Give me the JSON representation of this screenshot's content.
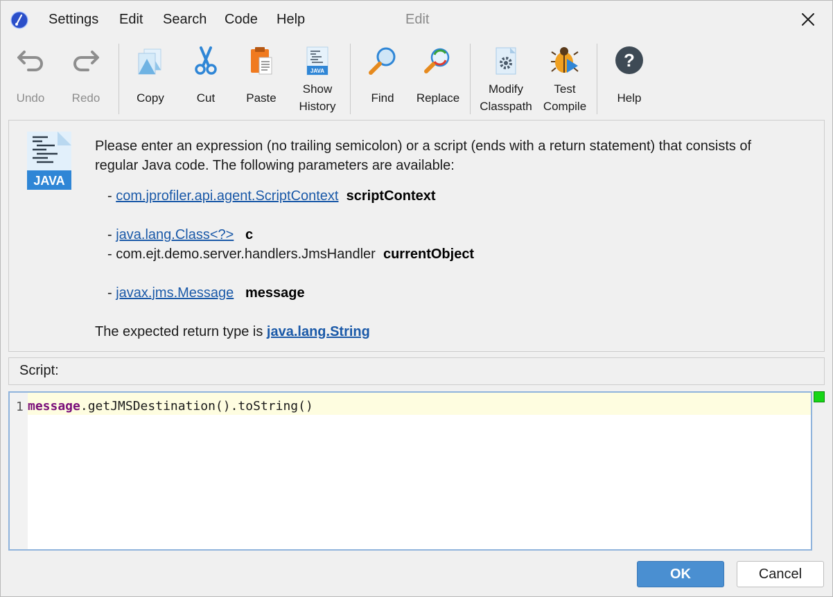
{
  "titlebar": {
    "menus": [
      "Settings",
      "Edit",
      "Search",
      "Code",
      "Help"
    ],
    "window_title": "Edit"
  },
  "toolbar": {
    "undo": "Undo",
    "redo": "Redo",
    "copy": "Copy",
    "cut": "Cut",
    "paste": "Paste",
    "show_history": [
      "Show",
      "History"
    ],
    "find": "Find",
    "replace": "Replace",
    "modify_classpath": [
      "Modify",
      "Classpath"
    ],
    "test_compile": [
      "Test",
      "Compile"
    ],
    "help": "Help"
  },
  "info": {
    "logo_text": "JAVA",
    "intro_line1": "Please enter an expression (no trailing semicolon) or a script (ends with a return statement) that consists of",
    "intro_line2": "regular Java code. The following parameters are available:",
    "params": [
      {
        "dash": "- ",
        "type": "com.jprofiler.api.agent.ScriptContext",
        "name": "scriptContext"
      },
      {
        "dash": "- ",
        "type": "java.lang.Class<?>",
        "name": "c"
      },
      {
        "dash": "- ",
        "type": "com.ejt.demo.server.handlers.JmsHandler",
        "name": "currentObject"
      },
      {
        "dash": "- ",
        "type": "javax.jms.Message",
        "name": "message"
      }
    ],
    "return_prefix": "The expected return type is ",
    "return_type": "java.lang.String"
  },
  "script": {
    "label": "Script:",
    "line_number": "1",
    "code_keyword": "message",
    "code_rest": ".getJMSDestination().toString()"
  },
  "buttons": {
    "ok": "OK",
    "cancel": "Cancel"
  },
  "colors": {
    "accent": "#4a8fd1",
    "link": "#1a59a8",
    "keyword": "#7a0f7a",
    "status_ok": "#16d616"
  }
}
